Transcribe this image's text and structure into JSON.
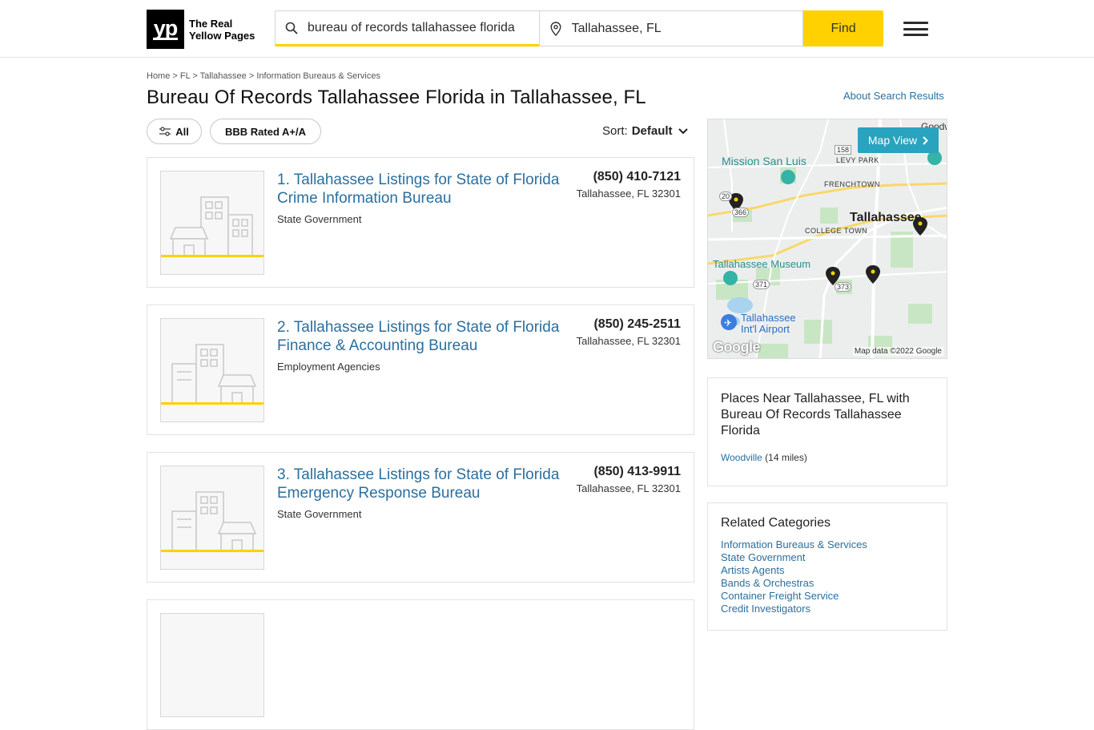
{
  "header": {
    "logo_mark": "yp",
    "logo_line1": "The Real",
    "logo_line2": "Yellow Pages",
    "search_what_value": "bureau of records tallahassee florida",
    "search_where_value": "Tallahassee, FL",
    "find_label": "Find"
  },
  "breadcrumb": [
    "Home",
    "FL",
    "Tallahassee",
    "Information Bureaus & Services"
  ],
  "page_title": "Bureau Of Records Tallahassee Florida in Tallahassee, FL",
  "about_link": "About Search Results",
  "filters": {
    "all_label": "All",
    "bbb_label": "BBB Rated A+/A"
  },
  "sort": {
    "label": "Sort:",
    "value": "Default"
  },
  "listings": [
    {
      "name_line1": "1. Tallahassee Listings for State of Florida",
      "name_line2": "Crime Information Bureau",
      "category": "State Government",
      "phone": "(850) 410-7121",
      "address": "Tallahassee, FL 32301"
    },
    {
      "name_line1": "2. Tallahassee Listings for State of Florida",
      "name_line2": "Finance & Accounting Bureau",
      "category": "Employment Agencies",
      "phone": "(850) 245-2511",
      "address": "Tallahassee, FL 32301"
    },
    {
      "name_line1": "3. Tallahassee Listings for State of Florida",
      "name_line2": "Emergency Response Bureau",
      "category": "State Government",
      "phone": "(850) 413-9911",
      "address": "Tallahassee, FL 32301"
    }
  ],
  "map": {
    "map_view_label": "Map View",
    "labels": {
      "mission": "Mission San Luis",
      "levy": "LEVY PARK",
      "frenchtown": "FRENCHTOWN",
      "tallahassee": "Tallahassee",
      "college": "COLLEGE TOWN",
      "museum": "Tallahassee Museum",
      "airport1": "Tallahassee",
      "airport2": "Int'l Airport",
      "goodwood": "Goodwo",
      "r158": "158",
      "r366": "366",
      "r371": "371",
      "r373": "373",
      "r20": "20"
    },
    "credit": "Map data ©2022 Google",
    "google": "Google"
  },
  "places_near": {
    "title": "Places Near Tallahassee, FL with Bureau Of Records Tallahassee Florida",
    "place_name": "Woodville",
    "place_distance": "(14 miles)"
  },
  "related": {
    "title": "Related Categories",
    "items": [
      "Information Bureaus & Services",
      "State Government",
      "Artists Agents",
      "Bands & Orchestras",
      "Container Freight Service",
      "Credit Investigators"
    ]
  },
  "colors": {
    "accent_yellow": "#ffd100",
    "link_blue": "#2b6f9e",
    "map_button": "#2aa3bf"
  }
}
